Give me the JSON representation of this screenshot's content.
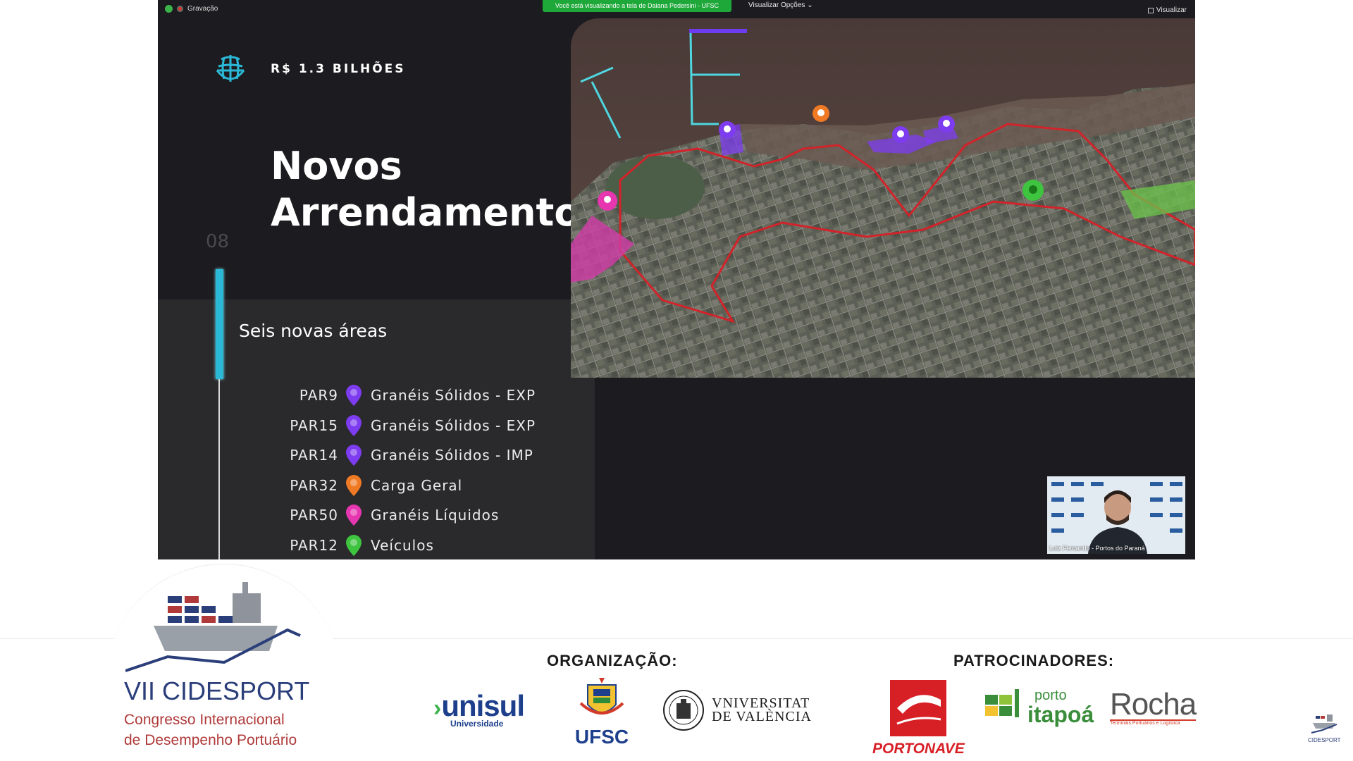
{
  "zoom": {
    "recording_label": "Gravação",
    "viewing_banner": "Você está visualizando a tela de Daiana Pedersini - UFSC",
    "view_options": "Visualizar Opções",
    "view_button": "Visualizar",
    "presenter_name": "Luiz Fernando - Portos do Paraná"
  },
  "slide": {
    "amount": "R$ 1.3 BILHÕES",
    "title_line1": "Novos",
    "title_line2": "Arrendamentos",
    "number": "08",
    "subtitle": "Seis novas áreas",
    "areas": [
      {
        "code": "PAR9",
        "label": "Granéis Sólidos - EXP",
        "color": "#7d3cf0"
      },
      {
        "code": "PAR15",
        "label": "Granéis Sólidos - EXP",
        "color": "#7d3cf0"
      },
      {
        "code": "PAR14",
        "label": "Granéis Sólidos - IMP",
        "color": "#7d3cf0"
      },
      {
        "code": "PAR32",
        "label": "Carga Geral",
        "color": "#f07a23"
      },
      {
        "code": "PAR50",
        "label": "Granéis Líquidos",
        "color": "#e637b0"
      },
      {
        "code": "PAR12",
        "label": "Veículos",
        "color": "#3fc43f"
      }
    ]
  },
  "banner": {
    "conference_title": "VII CIDESPORT",
    "conference_sub1": "Congresso Internacional",
    "conference_sub2": "de Desempenho Portuário",
    "org_heading": "ORGANIZAÇÃO:",
    "sponsors_heading": "PATROCINADORES:",
    "unisul": "unisul",
    "unisul_sub": "Universidade",
    "ufsc": "UFSC",
    "valencia_line1": "VNIVERSITAT",
    "valencia_line2": "DE VALÈNCIA",
    "portonave": "PORTONAVE",
    "itapoa_top": "porto",
    "itapoa_bottom": "itapoá",
    "rocha": "Rocha",
    "rocha_sub": "Terminais Portuários e Logística",
    "mini_logo": "CIDESPORT"
  }
}
